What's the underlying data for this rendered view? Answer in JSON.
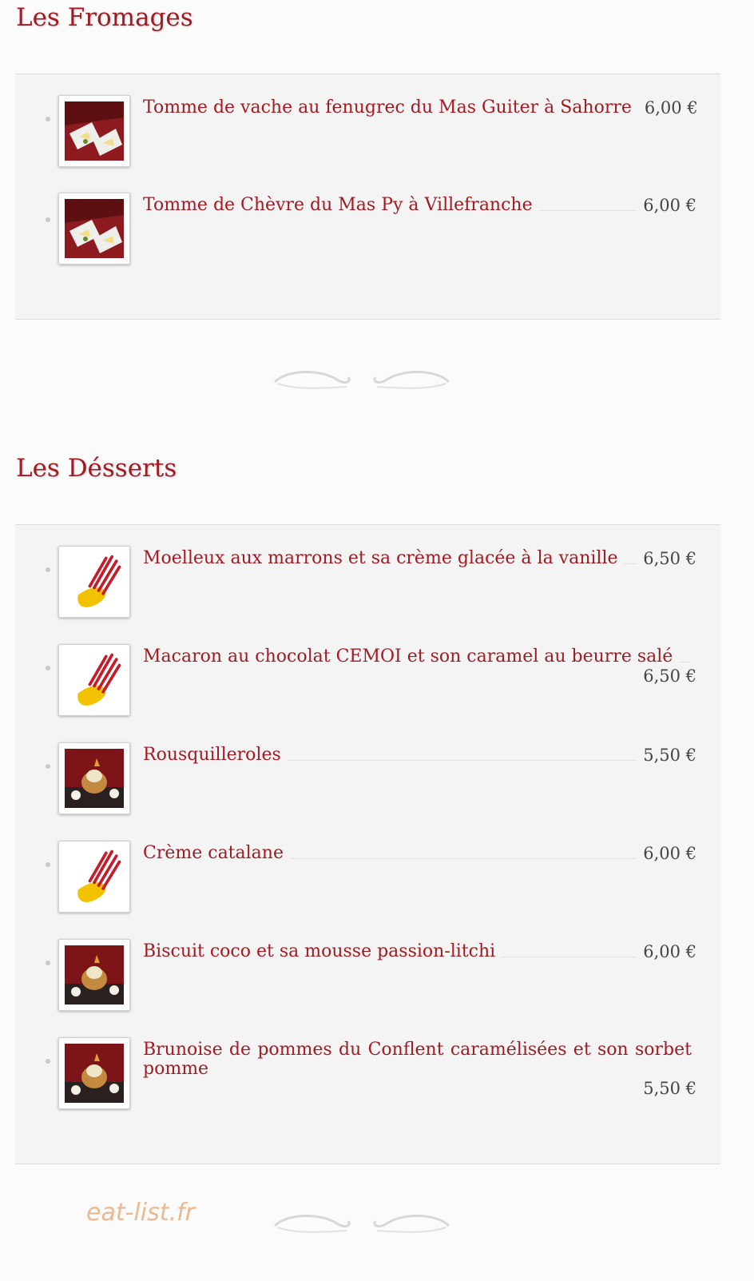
{
  "sections": [
    {
      "title": "Les Fromages",
      "items": [
        {
          "name": "Tomme de vache au fenugrec du Mas Guiter à Sahorre",
          "price": "6,00 €",
          "image": "cheese-plate-photo"
        },
        {
          "name": "Tomme de Chèvre du Mas Py à Villefranche",
          "price": "6,00 €",
          "image": "cheese-plate-photo"
        }
      ]
    },
    {
      "title": "Les Désserts",
      "items": [
        {
          "name": "Moelleux aux marrons et sa crème glacée à la vanille",
          "price": "6,50 €",
          "image": "fork-logo-icon"
        },
        {
          "name": "Macaron au chocolat CEMOI et son caramel au beurre salé",
          "price": "6,50 €",
          "image": "fork-logo-icon"
        },
        {
          "name": "Rousquilleroles",
          "price": "5,50 €",
          "image": "dessert-photo"
        },
        {
          "name": "Crème catalane",
          "price": "6,00 €",
          "image": "fork-logo-icon"
        },
        {
          "name": "Biscuit coco et sa mousse passion-litchi",
          "price": "6,00 €",
          "image": "dessert-photo"
        },
        {
          "name": "Brunoise de pommes du Conflent caramélisées et son sorbet pomme",
          "price": "5,50 €",
          "image": "dessert-photo"
        }
      ]
    }
  ],
  "watermark": "eat-list.fr",
  "colors": {
    "title": "#a21a22",
    "price": "#444444",
    "panel": "#f4f4f4",
    "watermark": "#ebb890"
  }
}
